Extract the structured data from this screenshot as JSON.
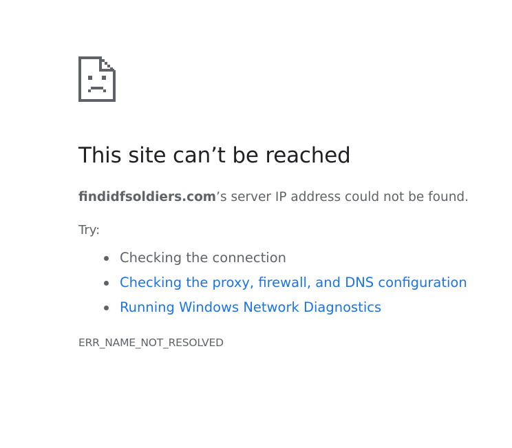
{
  "error": {
    "icon": "sad-page-icon",
    "title": "This site can’t be reached",
    "summary_host": "findidfsoldiers.com",
    "summary_rest": "’s server IP address could not be found.",
    "try_label": "Try:",
    "suggestions": [
      {
        "label": "Checking the connection",
        "link": false
      },
      {
        "label": "Checking the proxy, firewall, and DNS configuration",
        "link": true
      },
      {
        "label": "Running Windows Network Diagnostics",
        "link": true
      }
    ],
    "code": "ERR_NAME_NOT_RESOLVED"
  },
  "colors": {
    "text": "#5f6368",
    "heading": "#202124",
    "link": "#1a73e8",
    "icon": "#5f6368"
  }
}
